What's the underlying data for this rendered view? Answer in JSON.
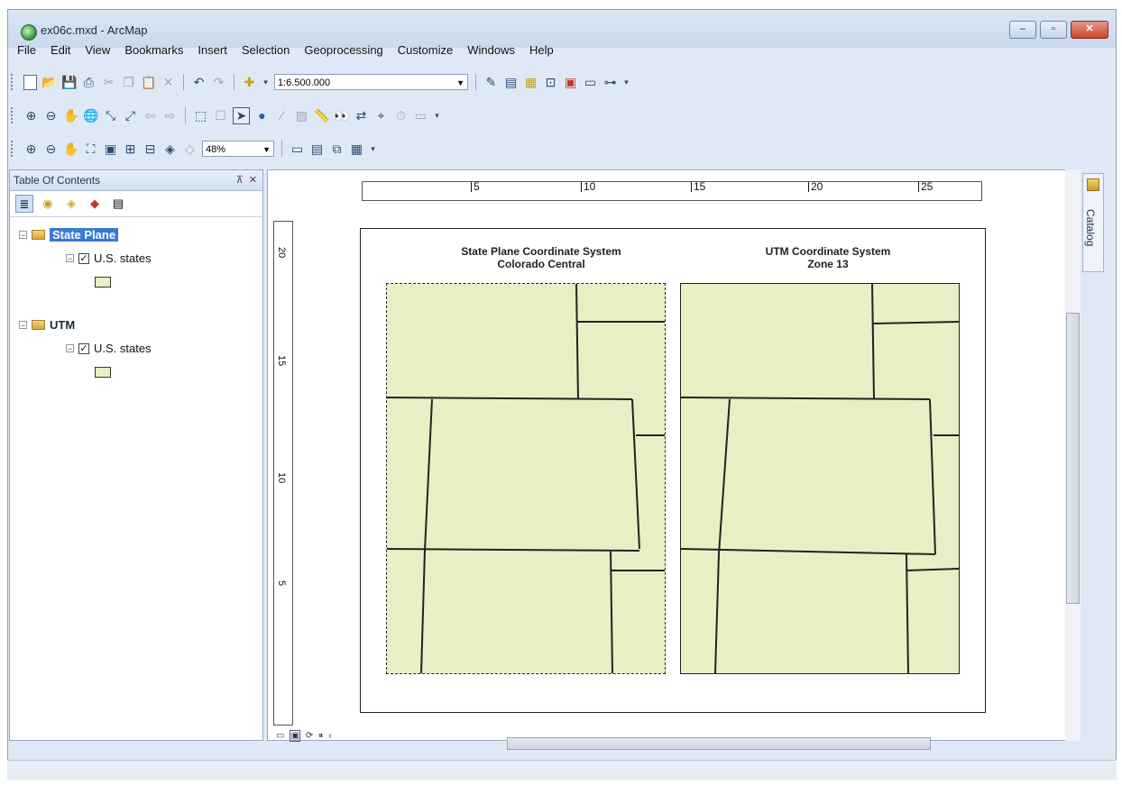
{
  "window": {
    "title": "ex06c.mxd - ArcMap"
  },
  "menu": [
    "File",
    "Edit",
    "View",
    "Bookmarks",
    "Insert",
    "Selection",
    "Geoprocessing",
    "Customize",
    "Windows",
    "Help"
  ],
  "toolbar": {
    "scale": "1:6.500.000",
    "zoom": "48%"
  },
  "toc": {
    "header": "Table Of Contents",
    "frames": [
      {
        "name": "State Plane",
        "layer": "U.S. states"
      },
      {
        "name": "UTM",
        "layer": "U.S. states"
      }
    ]
  },
  "layout": {
    "ruler_h": [
      "5",
      "10",
      "15",
      "20",
      "25"
    ],
    "ruler_v": [
      "20",
      "15",
      "10",
      "5"
    ],
    "map1": {
      "title1": "State Plane Coordinate System",
      "title2": "Colorado Central"
    },
    "map2": {
      "title1": "UTM Coordinate System",
      "title2": "Zone 13"
    }
  },
  "side": {
    "catalog": "Catalog"
  },
  "colors": {
    "fill": "#e8efc5",
    "selection": "#3a79d6"
  }
}
